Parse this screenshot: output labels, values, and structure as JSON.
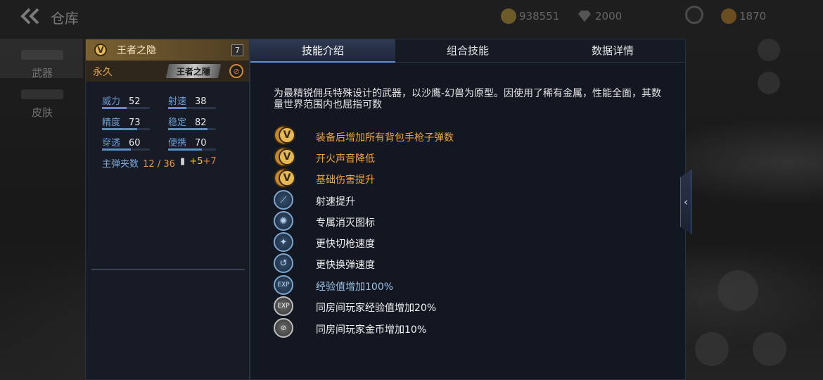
{
  "topbar": {
    "title": "仓库",
    "back_icon": "double-chevron-left-icon",
    "currencies": [
      {
        "icon": "gold-coin-icon",
        "value": "938551"
      },
      {
        "icon": "diamond-icon",
        "value": "2000"
      },
      {
        "icon": "token-icon",
        "value": "1870"
      }
    ]
  },
  "leftnav": {
    "items": [
      {
        "label": "武器",
        "active": true
      },
      {
        "label": "皮肤",
        "active": false
      }
    ]
  },
  "weapon": {
    "name": "王者之隐",
    "badge": "V",
    "level": "7",
    "duration": "永久",
    "emblem_text": "王者之隱",
    "stats": [
      {
        "name": "威力",
        "value": "52"
      },
      {
        "name": "射速",
        "value": "38"
      },
      {
        "name": "精度",
        "value": "73"
      },
      {
        "name": "稳定",
        "value": "82"
      },
      {
        "name": "穿透",
        "value": "60"
      },
      {
        "name": "便携",
        "value": "70"
      }
    ],
    "magazine_label": "主弹夹数",
    "magazine_value": "12 / 36",
    "bullet_plus1": "+5",
    "bullet_plus2": "+7"
  },
  "tabs": [
    "技能介绍",
    "组合技能",
    "数据详情"
  ],
  "active_tab": 0,
  "description": "为最精锐佣兵特殊设计的武器，以沙鹰-幻兽为原型。因使用了稀有金属，性能全面，其数量世界范围内也屈指可数",
  "skills": [
    {
      "icon": "pistol-icon",
      "style": "gold",
      "vip": true,
      "label": "装备后增加所有背包手枪子弹数",
      "color": "gold"
    },
    {
      "icon": "silencer-icon",
      "style": "gold",
      "vip": true,
      "label": "开火声音降低",
      "color": "gold"
    },
    {
      "icon": "damage-icon",
      "style": "gold",
      "vip": true,
      "label": "基础伤害提升",
      "color": "gold"
    },
    {
      "icon": "fire-rate-icon",
      "style": "blue",
      "vip": false,
      "label": "射速提升",
      "color": "white"
    },
    {
      "icon": "kill-emblem-icon",
      "style": "blue",
      "vip": false,
      "label": "专属消灭图标",
      "color": "white"
    },
    {
      "icon": "weapon-switch-icon",
      "style": "blue",
      "vip": false,
      "label": "更快切枪速度",
      "color": "white"
    },
    {
      "icon": "reload-icon",
      "style": "blue",
      "vip": false,
      "label": "更快换弹速度",
      "color": "white"
    },
    {
      "icon": "exp-icon",
      "style": "blue",
      "vip": false,
      "label": "经验值增加100%",
      "color": "blue"
    },
    {
      "icon": "room-exp-icon",
      "style": "gray",
      "vip": false,
      "label": "同房间玩家经验值增加20%",
      "color": "white"
    },
    {
      "icon": "room-coin-icon",
      "style": "gray",
      "vip": false,
      "label": "同房间玩家金币增加10%",
      "color": "white"
    }
  ],
  "colors": {
    "gold": "#f0a43c",
    "blue_text": "#9cc0e3",
    "accent": "#5e8ed0"
  }
}
